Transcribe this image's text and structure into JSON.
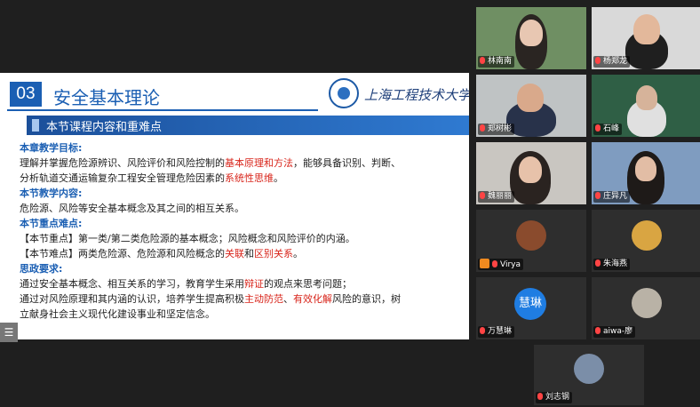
{
  "slide": {
    "section_number": "03",
    "section_title": "安全基本理论",
    "university": "上海工程技术大学",
    "section_bar": "本节课程内容和重难点",
    "h1": "本章教学目标:",
    "p1a": "理解并掌握危险源辨识、风险评价和风险控制的",
    "p1b": "基本原理和方法",
    "p1c": "，能够具备识别、判断、",
    "p2a": "分析轨道交通运输复杂工程安全管理危险因素的",
    "p2b": "系统性思维",
    "p2c": "。",
    "h2": "本节教学内容:",
    "p3": "危险源、风险等安全基本概念及其之间的相互关系。",
    "h3": "本节重点难点:",
    "p4": "【本节重点】第一类/第二类危险源的基本概念；风险概念和风险评价的内涵。",
    "p5a": "【本节难点】两类危险源、危险源和风险概念的",
    "p5b": "关联",
    "p5c": "和",
    "p5d": "区别关系",
    "p5e": "。",
    "h4": "思政要求:",
    "p6": "通过安全基本概念、相互关系的学习，教育学生采用",
    "p6b": "辩证",
    "p6c": "的观点来思考问题；",
    "p7a": "通过对风险原理和其内涵的认识，培养学生提高积极",
    "p7b": "主动防范",
    "p7c": "、",
    "p7d": "有效化解",
    "p7e": "风险的意识，树",
    "p8": "立献身社会主义现代化建设事业和坚定信念。",
    "toolbar_icon": "☰"
  },
  "participants": [
    {
      "name": "林南南"
    },
    {
      "name": "杨郑龙"
    },
    {
      "name": "郑树彬"
    },
    {
      "name": "石峰"
    },
    {
      "name": "魏丽丽"
    },
    {
      "name": "庄异凡"
    },
    {
      "name": "Virya"
    },
    {
      "name": "朱海燕"
    },
    {
      "name": "万慧琳",
      "avatar_text": "慧琳"
    },
    {
      "name": "aiwa-廖"
    },
    {
      "name": "刘志钢"
    }
  ],
  "colors": {
    "accent": "#1b5fb3",
    "highlight": "#d8241a",
    "avatar_blue": "#1f7de2"
  }
}
